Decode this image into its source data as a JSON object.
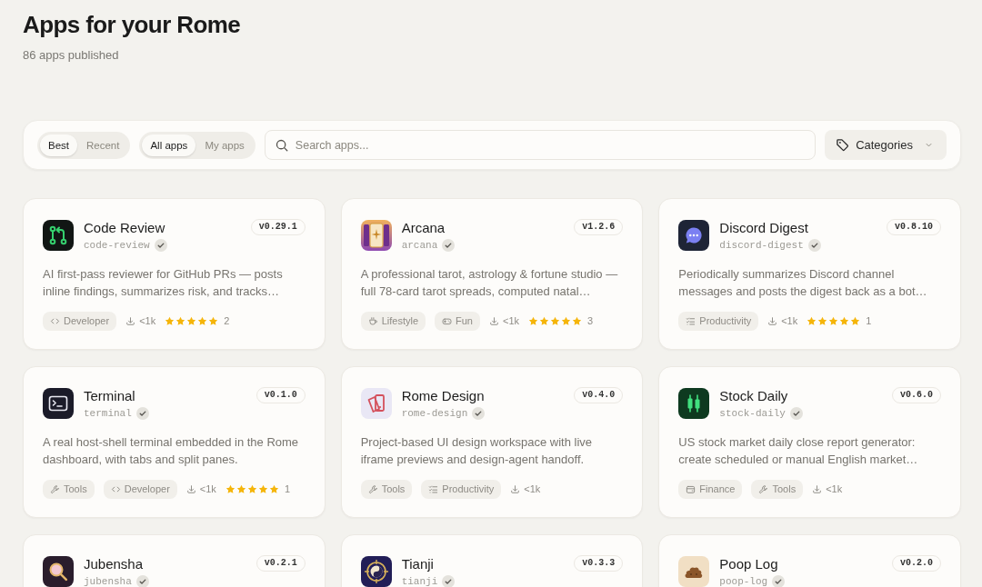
{
  "page": {
    "title": "Apps for your Rome",
    "subtitle": "86 apps published"
  },
  "toolbar": {
    "sort": [
      {
        "label": "Best",
        "selected": true
      },
      {
        "label": "Recent",
        "selected": false
      }
    ],
    "scope": [
      {
        "label": "All apps",
        "selected": true
      },
      {
        "label": "My apps",
        "selected": false
      }
    ],
    "search": {
      "placeholder": "Search apps..."
    },
    "categories": {
      "label": "Categories"
    }
  },
  "apps": [
    {
      "kind": "git",
      "name": "Code Review",
      "slug": "code-review",
      "verified": true,
      "version": "v0.29.1",
      "description": "AI first-pass reviewer for GitHub PRs — posts inline findings, summarizes risk, and tracks…",
      "tags": [
        {
          "kind": "developer",
          "label": "Developer"
        }
      ],
      "downloads": "<1k",
      "stars": 5,
      "rating_count": "2"
    },
    {
      "kind": "tarot",
      "name": "Arcana",
      "slug": "arcana",
      "verified": true,
      "version": "v1.2.6",
      "description": "A professional tarot, astrology & fortune studio — full 78-card tarot spreads, computed natal…",
      "tags": [
        {
          "kind": "lifestyle",
          "label": "Lifestyle"
        },
        {
          "kind": "fun",
          "label": "Fun"
        }
      ],
      "downloads": "<1k",
      "stars": 5,
      "rating_count": "3"
    },
    {
      "kind": "chat",
      "name": "Discord Digest",
      "slug": "discord-digest",
      "verified": true,
      "version": "v0.8.10",
      "description": "Periodically summarizes Discord channel messages and posts the digest back as a bot…",
      "tags": [
        {
          "kind": "productivity",
          "label": "Productivity"
        }
      ],
      "downloads": "<1k",
      "stars": 5,
      "rating_count": "1"
    },
    {
      "kind": "terminal",
      "name": "Terminal",
      "slug": "terminal",
      "verified": true,
      "version": "v0.1.0",
      "description": "A real host-shell terminal embedded in the Rome dashboard, with tabs and split panes.",
      "tags": [
        {
          "kind": "tools",
          "label": "Tools"
        },
        {
          "kind": "developer",
          "label": "Developer"
        }
      ],
      "downloads": "<1k",
      "stars": 5,
      "rating_count": "1"
    },
    {
      "kind": "swatch",
      "name": "Rome Design",
      "slug": "rome-design",
      "verified": true,
      "version": "v0.4.0",
      "description": "Project-based UI design workspace with live iframe previews and design-agent handoff.",
      "tags": [
        {
          "kind": "tools",
          "label": "Tools"
        },
        {
          "kind": "productivity",
          "label": "Productivity"
        }
      ],
      "downloads": "<1k"
    },
    {
      "kind": "candles",
      "name": "Stock Daily",
      "slug": "stock-daily",
      "verified": true,
      "version": "v0.6.0",
      "description": "US stock market daily close report generator: create scheduled or manual English market…",
      "tags": [
        {
          "kind": "finance",
          "label": "Finance"
        },
        {
          "kind": "tools",
          "label": "Tools"
        }
      ],
      "downloads": "<1k"
    },
    {
      "kind": "magnifier",
      "name": "Jubensha",
      "slug": "jubensha",
      "verified": true,
      "version": "v0.2.1"
    },
    {
      "kind": "yinyang",
      "name": "Tianji",
      "slug": "tianji",
      "verified": true,
      "version": "v0.3.3"
    },
    {
      "kind": "poop",
      "name": "Poop Log",
      "slug": "poop-log",
      "verified": true,
      "version": "v0.2.0"
    }
  ]
}
